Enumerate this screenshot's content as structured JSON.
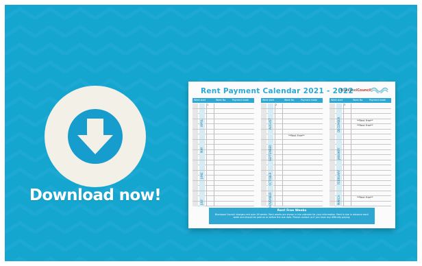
{
  "cta": {
    "label": "Download now!"
  },
  "card": {
    "title": "Rent Payment Calendar 2021 - 2022",
    "logo_black": "Blackpool",
    "logo_red": "Council",
    "columns": [
      {
        "headers": [
          "Week start",
          "Week No.",
          "Payment made"
        ],
        "months": [
          "APRIL",
          "MAY",
          "JUNE",
          "JULY"
        ],
        "first_number": "1",
        "note": ""
      },
      {
        "headers": [
          "Week start",
          "Week No.",
          "Payment made"
        ],
        "months": [
          "AUGUST",
          "SEPTEMBER",
          "OCTOBER",
          "NOVEMBER"
        ],
        "first_number": "2",
        "note": "**Rent Free**"
      },
      {
        "headers": [
          "Week start",
          "Week No.",
          "Payment made"
        ],
        "months": [
          "DECEMBER",
          "JANUARY",
          "FEBRUARY",
          "MARCH"
        ],
        "first_number": "3",
        "note": "**Rent Free**"
      }
    ],
    "footer_heading": "Rent Free Weeks",
    "footer_text": "Blackpool Council charges rent over 48 weeks. Rent weeks are shown in the calendar for your information. Rent is due in advance each week and should be paid on or before the due date. Please contact us if you have any difficulty paying."
  },
  "colors": {
    "background": "#15a6cf",
    "accent": "#2ea8d2",
    "badge": "#f3f0e8"
  },
  "icons": {
    "download": "download-arrow-icon"
  }
}
